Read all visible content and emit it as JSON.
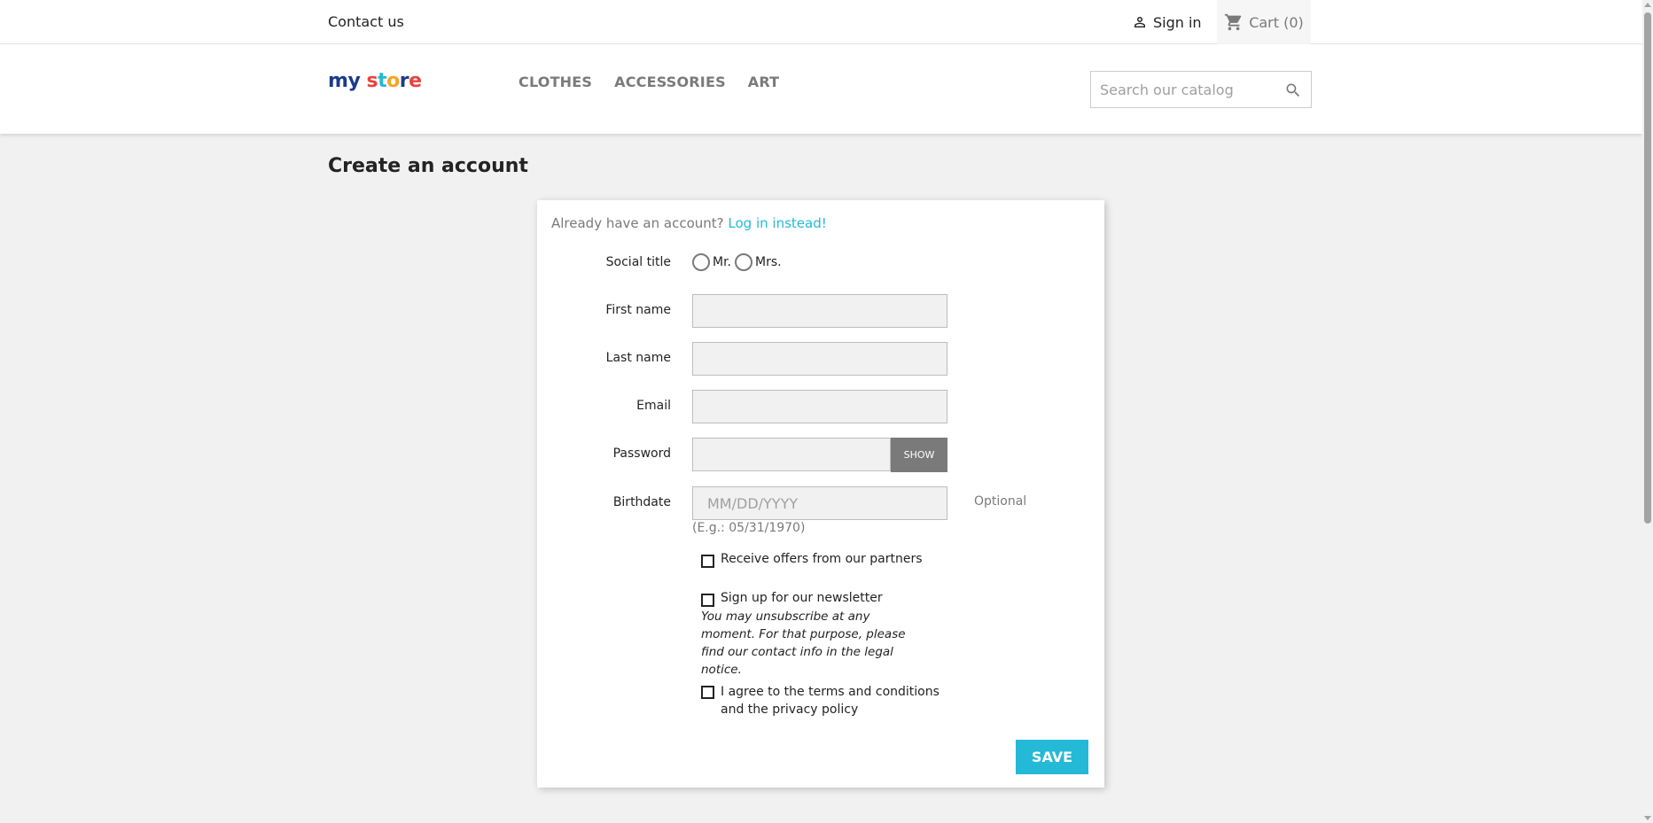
{
  "topnav": {
    "contact_label": "Contact us",
    "signin_label": "Sign in",
    "cart_label": "Cart",
    "cart_count": "(0)"
  },
  "header": {
    "logo_text": "my store",
    "menu": [
      "CLOTHES",
      "ACCESSORIES",
      "ART"
    ],
    "search_placeholder": "Search our catalog"
  },
  "page": {
    "title": "Create an account"
  },
  "form": {
    "login_prompt": "Already have an account?",
    "login_link": "Log in instead!",
    "social_title_label": "Social title",
    "social_options": [
      "Mr.",
      "Mrs."
    ],
    "first_name_label": "First name",
    "last_name_label": "Last name",
    "email_label": "Email",
    "password_label": "Password",
    "show_label": "SHOW",
    "birthdate_label": "Birthdate",
    "birthdate_placeholder": "MM/DD/YYYY",
    "optional_label": "Optional",
    "birthdate_hint": "(E.g.: 05/31/1970)",
    "partner_offers_label": "Receive offers from our partners",
    "newsletter_label": "Sign up for our newsletter",
    "newsletter_note": "You may unsubscribe at any moment. For that purpose, please find our contact info in the legal notice.",
    "terms_label": "I agree to the terms and conditions and the privacy policy",
    "save_label": "SAVE"
  },
  "colors": {
    "accent": "#24b9d7",
    "text": "#232323",
    "muted": "#7a7a7a",
    "background": "#f1f1f1"
  }
}
